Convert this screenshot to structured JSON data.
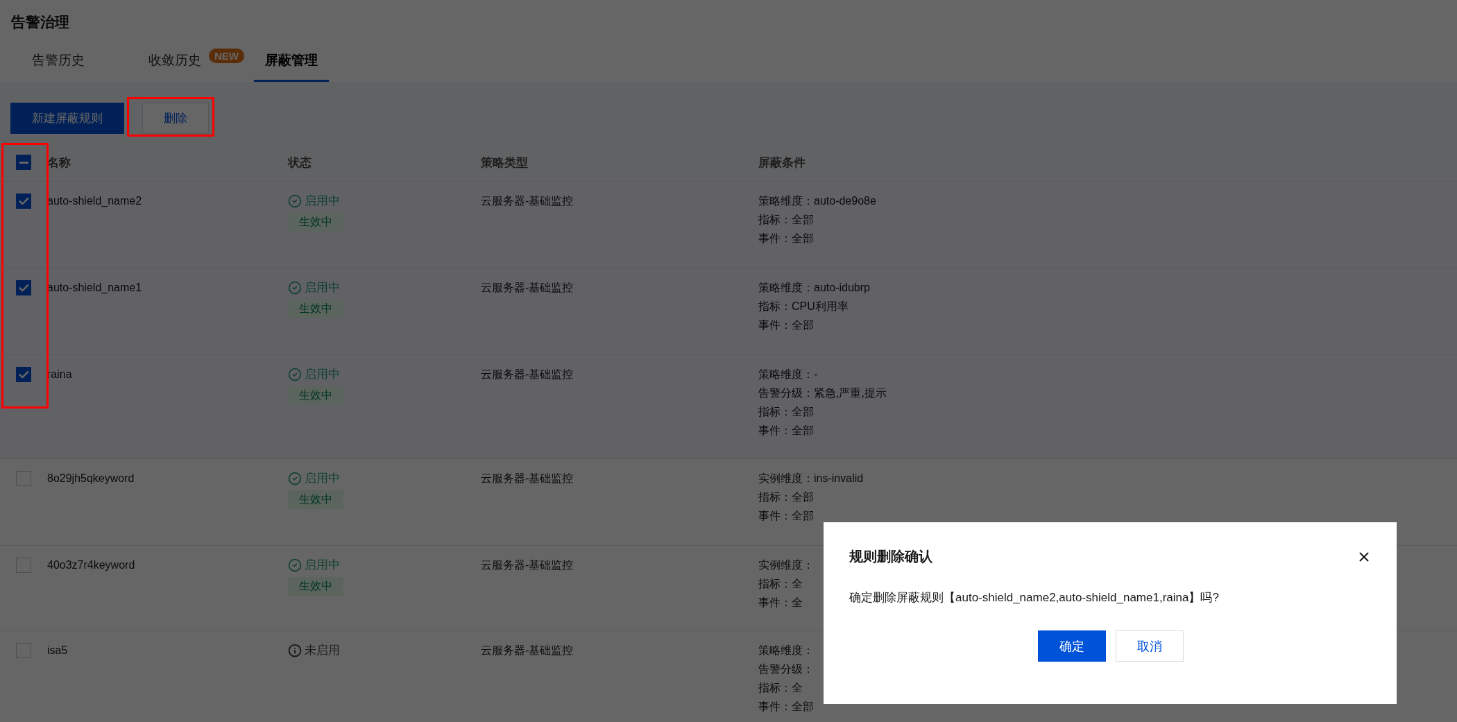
{
  "page_title": "告警治理",
  "tabs": [
    {
      "label": "告警历史",
      "selected": false
    },
    {
      "label": "收敛历史",
      "selected": false,
      "badge": "NEW"
    },
    {
      "label": "屏蔽管理",
      "selected": true
    }
  ],
  "toolbar": {
    "buttons": [
      {
        "label": "新建屏蔽规则",
        "kind": "primary",
        "highlighted": false
      },
      {
        "label": "删除",
        "kind": "default",
        "highlighted": true
      }
    ]
  },
  "table": {
    "header_checkbox": {
      "indeterminate": true
    },
    "checkbox_column_highlighted": true,
    "columns": [
      "名称",
      "状态",
      "策略类型",
      "屏蔽条件"
    ],
    "rows": [
      {
        "name": "auto-shield_name2",
        "selected": true,
        "status": {
          "kind": "enabled",
          "label": "启用中",
          "tag": "生效中"
        },
        "type": "云服务器-基础监控",
        "conditions": [
          "策略维度：auto-de9o8e",
          "指标：全部",
          "事件：全部"
        ]
      },
      {
        "name": "auto-shield_name1",
        "selected": true,
        "status": {
          "kind": "enabled",
          "label": "启用中",
          "tag": "生效中"
        },
        "type": "云服务器-基础监控",
        "conditions": [
          "策略维度：auto-idubrp",
          "指标：CPU利用率",
          "事件：全部"
        ]
      },
      {
        "name": "raina",
        "selected": true,
        "status": {
          "kind": "enabled",
          "label": "启用中",
          "tag": "生效中"
        },
        "type": "云服务器-基础监控",
        "conditions": [
          "策略维度：-",
          "告警分级：紧急,严重,提示",
          "指标：全部",
          "事件：全部"
        ]
      },
      {
        "name": "8o29jh5qkeyword",
        "selected": false,
        "status": {
          "kind": "enabled",
          "label": "启用中",
          "tag": "生效中"
        },
        "type": "云服务器-基础监控",
        "conditions": [
          "实例维度：ins-invalid",
          "指标：全部",
          "事件：全部"
        ]
      },
      {
        "name": "40o3z7r4keyword",
        "selected": false,
        "status": {
          "kind": "enabled",
          "label": "启用中",
          "tag": "生效中"
        },
        "type": "云服务器-基础监控",
        "conditions": [
          "实例维度：",
          "指标：全",
          "事件：全"
        ]
      },
      {
        "name": "isa5",
        "selected": false,
        "status": {
          "kind": "disabled",
          "label": "未启用"
        },
        "type": "云服务器-基础监控",
        "conditions": [
          "策略维度：",
          "告警分级：",
          "指标：全",
          "事件：全部"
        ]
      }
    ]
  },
  "dialog": {
    "title": "规则删除确认",
    "message": "确定删除屏蔽规则【auto-shield_name2,auto-shield_name1,raina】吗?",
    "buttons": [
      {
        "label": "确定",
        "kind": "primary"
      },
      {
        "label": "取消",
        "kind": "default"
      }
    ]
  }
}
